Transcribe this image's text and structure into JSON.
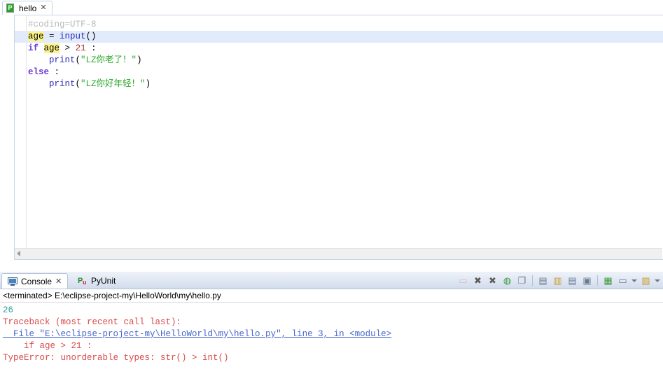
{
  "editor": {
    "tab": {
      "icon": "python-file-icon",
      "title": "hello",
      "close": "✕"
    },
    "code": [
      {
        "current": false,
        "tokens": [
          {
            "text": "#coding=UTF-8",
            "cls": "tok-comment"
          }
        ]
      },
      {
        "current": true,
        "tokens": [
          {
            "text": "age",
            "cls": "tok-plain",
            "hl": true
          },
          {
            "text": " = ",
            "cls": "tok-op"
          },
          {
            "text": "input",
            "cls": "tok-builtin"
          },
          {
            "text": "()",
            "cls": "tok-plain"
          }
        ]
      },
      {
        "current": false,
        "tokens": [
          {
            "text": "if",
            "cls": "tok-kw"
          },
          {
            "text": " ",
            "cls": "tok-plain"
          },
          {
            "text": "age",
            "cls": "tok-plain",
            "hl": true
          },
          {
            "text": " > ",
            "cls": "tok-op"
          },
          {
            "text": "21",
            "cls": "tok-num"
          },
          {
            "text": " :",
            "cls": "tok-plain"
          }
        ]
      },
      {
        "current": false,
        "tokens": [
          {
            "text": "    ",
            "cls": "tok-plain"
          },
          {
            "text": "print",
            "cls": "tok-builtin"
          },
          {
            "text": "(",
            "cls": "tok-plain"
          },
          {
            "text": "\"LZ你老了！\"",
            "cls": "tok-string"
          },
          {
            "text": ")",
            "cls": "tok-plain"
          }
        ]
      },
      {
        "current": false,
        "tokens": [
          {
            "text": "else",
            "cls": "tok-kw"
          },
          {
            "text": " :",
            "cls": "tok-plain"
          }
        ]
      },
      {
        "current": false,
        "tokens": [
          {
            "text": "    ",
            "cls": "tok-plain"
          },
          {
            "text": "print",
            "cls": "tok-builtin"
          },
          {
            "text": "(",
            "cls": "tok-plain"
          },
          {
            "text": "\"LZ你好年轻！\"",
            "cls": "tok-string"
          },
          {
            "text": ")",
            "cls": "tok-plain"
          }
        ]
      }
    ],
    "scrollbar": {
      "left_arrow": "scroll-left-arrow"
    }
  },
  "console": {
    "tabs": [
      {
        "label": "Console",
        "icon": "console-icon",
        "close": "✕",
        "active": true
      },
      {
        "label": "PyUnit",
        "icon": "pyunit-icon",
        "active": false
      }
    ],
    "toolbar": [
      {
        "name": "terminate-button",
        "glyph": "▭",
        "color": "#c08a8a",
        "disabled": true
      },
      {
        "name": "remove-launch-button",
        "glyph": "✖",
        "color": "#5b5b5b"
      },
      {
        "name": "remove-all-terminated-button",
        "glyph": "✖",
        "color": "#5b5b5b"
      },
      {
        "name": "show-console-when-output-button",
        "glyph": "◍",
        "color": "#3a9a3a"
      },
      {
        "name": "pin-console-button",
        "glyph": "❐",
        "color": "#6b7b90"
      },
      {
        "name": "separator-1",
        "glyph": "",
        "separator": true
      },
      {
        "name": "clear-console-button",
        "glyph": "▤",
        "color": "#6b7b90"
      },
      {
        "name": "scroll-lock-button",
        "glyph": "▥",
        "color": "#c8a030"
      },
      {
        "name": "word-wrap-button",
        "glyph": "▤",
        "color": "#6b7b90"
      },
      {
        "name": "close-console-button",
        "glyph": "▣",
        "color": "#6b7b90"
      },
      {
        "name": "separator-2",
        "glyph": "",
        "separator": true
      },
      {
        "name": "open-console-button",
        "glyph": "▦",
        "color": "#3a9a3a"
      },
      {
        "name": "display-selected-console-button",
        "glyph": "▭",
        "color": "#6b7b90"
      },
      {
        "name": "display-selected-console-dropdown",
        "glyph": "",
        "arrow": true
      },
      {
        "name": "new-console-view-button",
        "glyph": "▧",
        "color": "#c8a030"
      },
      {
        "name": "new-console-view-dropdown",
        "glyph": "",
        "arrow": true
      }
    ],
    "terminated_line": "<terminated> E:\\eclipse-project-my\\HelloWorld\\my\\hello.py",
    "output": [
      {
        "text": "26",
        "style": "out-stdout"
      },
      {
        "text": "Traceback (most recent call last):",
        "style": "out-stderr"
      },
      {
        "text": "  File \"E:\\eclipse-project-my\\HelloWorld\\my\\hello.py\", line 3, in <module>",
        "style": "out-link"
      },
      {
        "text": "    if age > 21 :",
        "style": "out-stderr"
      },
      {
        "text": "TypeError: unorderable types: str() > int()",
        "style": "out-stderr"
      }
    ]
  },
  "colors": {
    "current_line": "#e1ebfb",
    "occurrence_highlight": "#fbf38b",
    "string": "#2da82d",
    "keyword": "#6a3ad6",
    "stdout": "#2e9e9e",
    "stderr": "#d94a4a",
    "link": "#4466cc"
  }
}
